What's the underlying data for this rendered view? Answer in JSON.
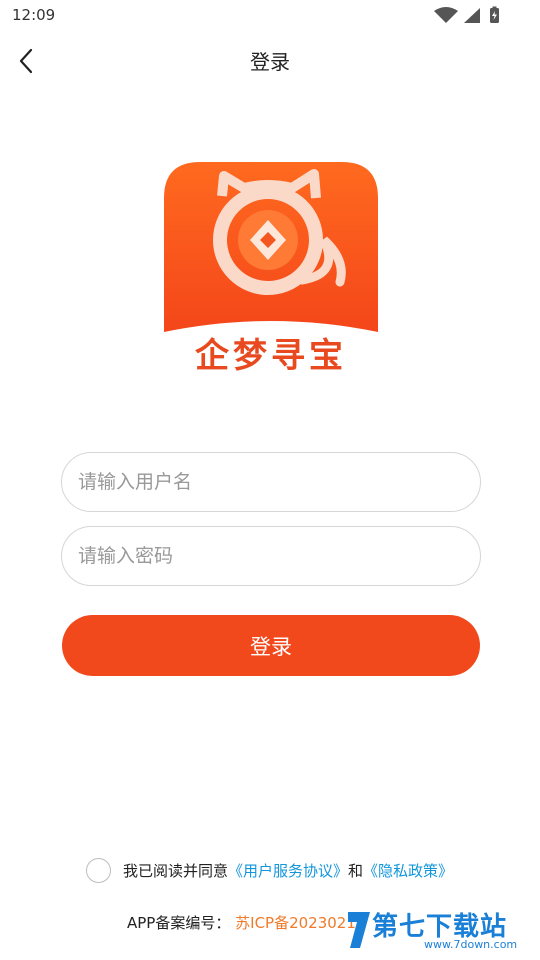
{
  "status_bar": {
    "time": "12:09"
  },
  "nav": {
    "title": "登录"
  },
  "logo": {
    "text": "企梦寻宝"
  },
  "form": {
    "username_placeholder": "请输入用户名",
    "password_placeholder": "请输入密码",
    "username_value": "",
    "password_value": "",
    "login_label": "登录"
  },
  "agreement": {
    "prefix": "我已阅读并同意",
    "service_link": "《用户服务协议》",
    "conjunction": "和",
    "privacy_link": "《隐私政策》"
  },
  "icp": {
    "label": "APP备案编号：",
    "value": "苏ICP备2023021"
  },
  "watermark": {
    "text": "第七下载站",
    "sub": "www.7down.com"
  },
  "colors": {
    "accent": "#f2491c",
    "logo_orange": "#ff6a1f",
    "link": "#1296db",
    "icp_value": "#f07a2a"
  }
}
